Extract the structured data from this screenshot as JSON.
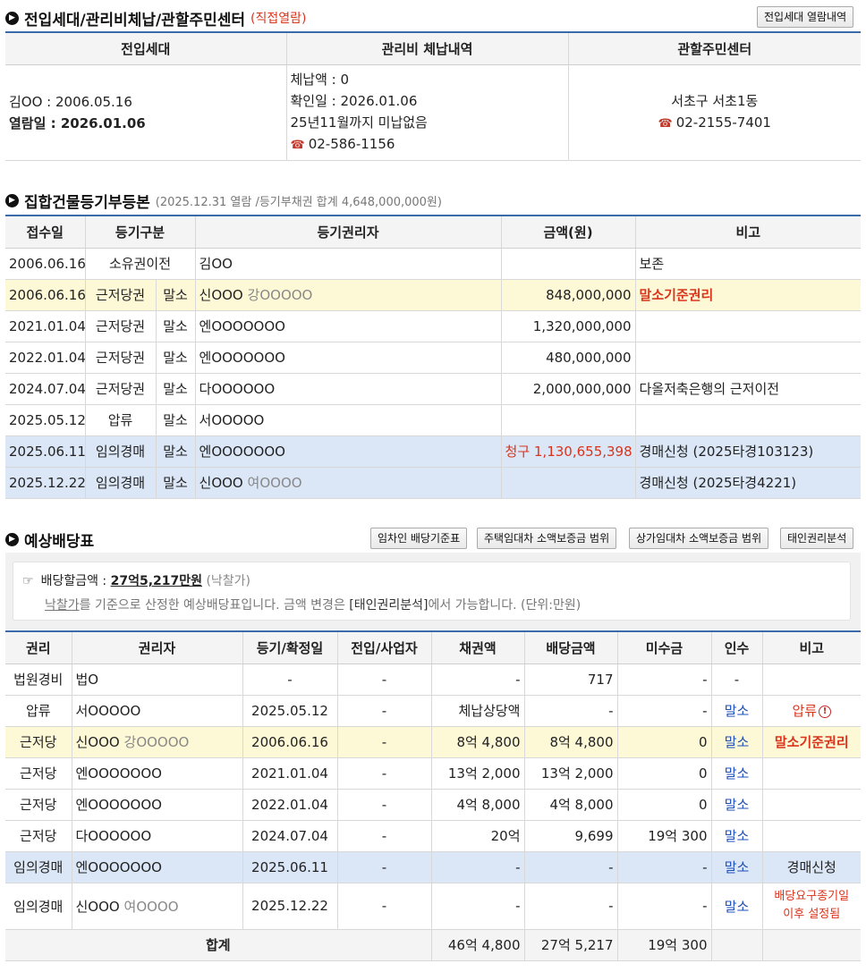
{
  "section1": {
    "title": "전입세대/관리비체납/관할주민센터",
    "tag": "(직접열람)",
    "button": "전입세대 열람내역",
    "headers": [
      "전입세대",
      "관리비 체납내역",
      "관할주민센터"
    ],
    "resident_line": "김OO : 2006.05.16",
    "view_label": "열람일 : ",
    "view_date": "2026.01.06",
    "arrears": [
      "체납액 : 0",
      "확인일 : 2026.01.06",
      "25년11월까지 미납없음"
    ],
    "arrears_phone": "02-586-1156",
    "center_name": "서초구 서초1동",
    "center_phone": "02-2155-7401"
  },
  "section2": {
    "title": "집합건물등기부등본",
    "note": "(2025.12.31 열람 /등기부채권 합계 4,648,000,000원)",
    "headers": [
      "접수일",
      "등기구분",
      "등기권리자",
      "금액(원)",
      "비고"
    ],
    "rows": [
      {
        "date": "2006.06.16",
        "type": "소유권이전",
        "mal": "",
        "holder": "김OO",
        "holder2": "",
        "amount_prefix": "",
        "amount": "",
        "note": "보존"
      },
      {
        "date": "2006.06.16",
        "type": "근저당권",
        "mal": "말소",
        "holder": "신OOO",
        "holder2": "강OOOOO",
        "amount_prefix": "",
        "amount": "848,000,000",
        "note": "말소기준권리"
      },
      {
        "date": "2021.01.04",
        "type": "근저당권",
        "mal": "말소",
        "holder": "엔OOOOOOO",
        "holder2": "",
        "amount_prefix": "",
        "amount": "1,320,000,000",
        "note": ""
      },
      {
        "date": "2022.01.04",
        "type": "근저당권",
        "mal": "말소",
        "holder": "엔OOOOOOO",
        "holder2": "",
        "amount_prefix": "",
        "amount": "480,000,000",
        "note": ""
      },
      {
        "date": "2024.07.04",
        "type": "근저당권",
        "mal": "말소",
        "holder": "다OOOOOO",
        "holder2": "",
        "amount_prefix": "",
        "amount": "2,000,000,000",
        "note": "다올저축은행의 근저이전"
      },
      {
        "date": "2025.05.12",
        "type": "압류",
        "mal": "말소",
        "holder": "서OOOOO",
        "holder2": "",
        "amount_prefix": "",
        "amount": "",
        "note": ""
      },
      {
        "date": "2025.06.11",
        "type": "임의경매",
        "mal": "말소",
        "holder": "엔OOOOOOO",
        "holder2": "",
        "amount_prefix": "청구 ",
        "amount": "1,130,655,398",
        "note": "경매신청 (2025타경103123)"
      },
      {
        "date": "2025.12.22",
        "type": "임의경매",
        "mal": "말소",
        "holder": "신OOO",
        "holder2": "여OOOO",
        "amount_prefix": "",
        "amount": "",
        "note": "경매신청 (2025타경4221)"
      }
    ]
  },
  "section3": {
    "title": "예상배당표",
    "buttons": [
      "임차인 배당기준표",
      "주택임대차 소액보증금 범위",
      "상가임대차 소액보증금 범위",
      "태인권리분석"
    ],
    "info_hand": "☞",
    "info_label": "배당할금액 : ",
    "info_amount": "27억5,217만원",
    "info_suffix": " (낙찰가)",
    "info_line2_a": "낙찰가",
    "info_line2_b": "를 기준으로 산정한 예상배당표입니다. 금액 변경은 ",
    "info_line2_c": "[태인권리분석]",
    "info_line2_d": "에서 가능합니다. (단위:만원)",
    "headers": [
      "권리",
      "권리자",
      "등기/확정일",
      "전입/사업자",
      "채권액",
      "배당금액",
      "미수금",
      "인수",
      "비고"
    ],
    "rows": [
      {
        "right": "법원경비",
        "holder": "법O",
        "holder2": "",
        "date": "-",
        "move": "-",
        "claim": "-",
        "paid": "717",
        "unpaid": "-",
        "take": "-",
        "note": ""
      },
      {
        "right": "압류",
        "holder": "서OOOOO",
        "holder2": "",
        "date": "2025.05.12",
        "move": "-",
        "claim": "체납상당액",
        "paid": "-",
        "unpaid": "-",
        "take": "말소",
        "note": "압류"
      },
      {
        "right": "근저당",
        "holder": "신OOO",
        "holder2": "강OOOOO",
        "date": "2006.06.16",
        "move": "-",
        "claim": "8억 4,800",
        "paid": "8억 4,800",
        "unpaid": "0",
        "take": "말소",
        "note": "말소기준권리"
      },
      {
        "right": "근저당",
        "holder": "엔OOOOOOO",
        "holder2": "",
        "date": "2021.01.04",
        "move": "-",
        "claim": "13억 2,000",
        "paid": "13억 2,000",
        "unpaid": "0",
        "take": "말소",
        "note": ""
      },
      {
        "right": "근저당",
        "holder": "엔OOOOOOO",
        "holder2": "",
        "date": "2022.01.04",
        "move": "-",
        "claim": "4억 8,000",
        "paid": "4억 8,000",
        "unpaid": "0",
        "take": "말소",
        "note": ""
      },
      {
        "right": "근저당",
        "holder": "다OOOOOO",
        "holder2": "",
        "date": "2024.07.04",
        "move": "-",
        "claim": "20억",
        "paid": "9,699",
        "unpaid": "19억 300",
        "take": "말소",
        "note": ""
      },
      {
        "right": "임의경매",
        "holder": "엔OOOOOOO",
        "holder2": "",
        "date": "2025.06.11",
        "move": "-",
        "claim": "-",
        "paid": "-",
        "unpaid": "-",
        "take": "말소",
        "note": "경매신청"
      },
      {
        "right": "임의경매",
        "holder": "신OOO",
        "holder2": "여OOOO",
        "date": "2025.12.22",
        "move": "-",
        "claim": "-",
        "paid": "-",
        "unpaid": "-",
        "take": "말소",
        "note": "배당요구종기일",
        "note2": "이후 설정됨"
      }
    ],
    "total_label": "합계",
    "total_claim": "46억 4,800",
    "total_paid": "27억 5,217",
    "total_unpaid": "19억 300"
  }
}
